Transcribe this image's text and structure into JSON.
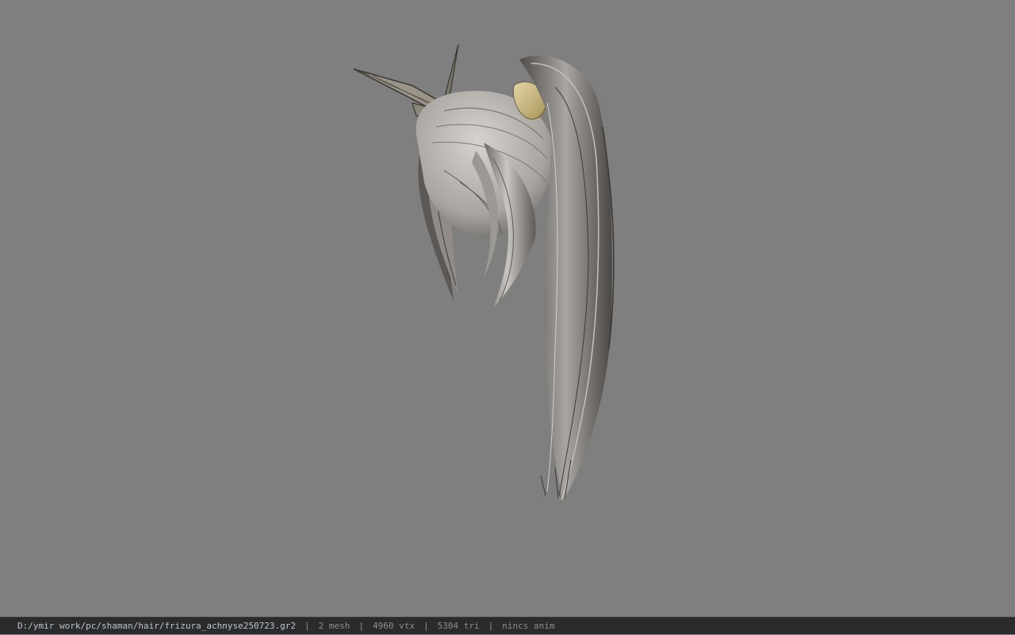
{
  "viewport": {
    "background_color": "#7f7f7f",
    "model": "hair-mesh"
  },
  "status_bar": {
    "file_path": "D:/ymir work/pc/shaman/hair/frizura_achnyse250723.gr2",
    "mesh_count": "2 mesh",
    "vertex_count": "4960 vtx",
    "triangle_count": "5304 tri",
    "anim_status": "nincs anim",
    "separator": "|"
  }
}
